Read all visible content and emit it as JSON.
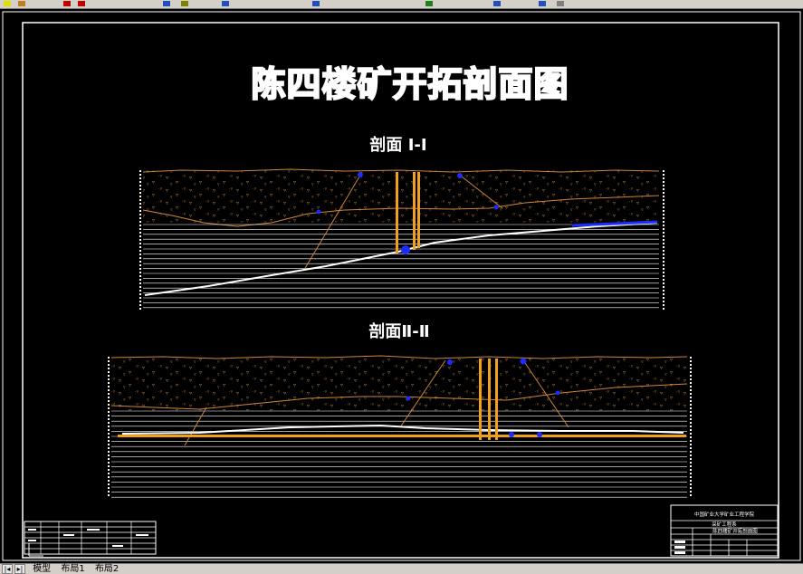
{
  "drawing": {
    "title": "陈四楼矿开拓剖面图",
    "section1_label": "剖面 Ⅰ-Ⅰ",
    "section2_label": "剖面Ⅱ-Ⅱ"
  },
  "title_block": {
    "line1": "中国矿业大学矿业工程学院",
    "line2": "采矿工程系",
    "line3": "陈四楼矿开拓剖面图"
  },
  "layout_tabs": {
    "model": "模型",
    "layout1": "布局1",
    "layout2": "布局2"
  },
  "colors": {
    "background": "#000000",
    "frame": "#ffffff",
    "topsoil_boundary": "#d0863a",
    "shaft": "#f0a020",
    "coal_seam": "#ffffff",
    "roadway": "#1a2cff",
    "ui_chrome": "#d4d0c8"
  }
}
